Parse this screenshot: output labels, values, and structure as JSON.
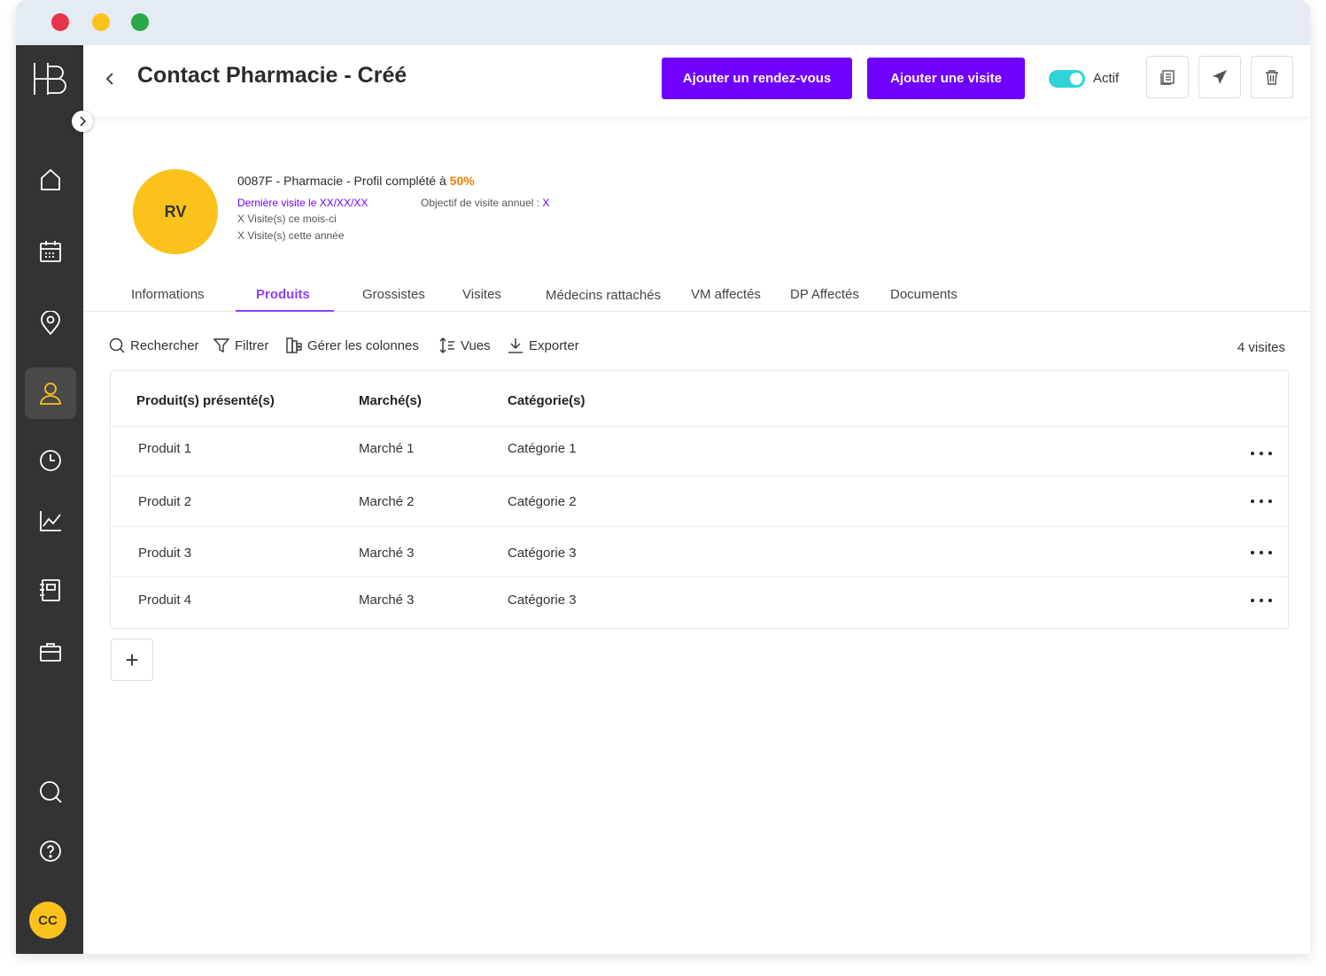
{
  "window": {
    "colors": {
      "close": "#e8334a",
      "minimize": "#fbc21b",
      "maximize": "#29a847"
    }
  },
  "sidebar": {
    "logo_text": "HB",
    "items": [
      {
        "name": "home-icon"
      },
      {
        "name": "calendar-icon"
      },
      {
        "name": "map-pin-icon"
      },
      {
        "name": "user-icon",
        "active": true
      },
      {
        "name": "clock-icon"
      },
      {
        "name": "chart-icon"
      },
      {
        "name": "notebook-icon"
      },
      {
        "name": "briefcase-icon"
      },
      {
        "name": "search-icon"
      },
      {
        "name": "help-icon"
      }
    ],
    "user_initials": "CC"
  },
  "header": {
    "title": "Contact Pharmacie - Créé",
    "add_appointment_label": "Ajouter un rendez-vous",
    "add_visit_label": "Ajouter une visite",
    "toggle_label": "Actif",
    "accent_color": "#7000ff"
  },
  "profile": {
    "initials": "RV",
    "name_prefix": "0087F - Pharmacie  - Profil complété à ",
    "completion": "50%",
    "last_visit": "Dernière visite le XX/XX/XX",
    "objective_label": "Objectif de visite annuel : ",
    "objective_value": "X",
    "visits_month": "X Visite(s) ce mois-ci",
    "visits_year": "X Visite(s) cette année"
  },
  "tabs": [
    {
      "label": "Informations"
    },
    {
      "label": "Produits",
      "active": true
    },
    {
      "label": "Grossistes"
    },
    {
      "label": "Visites"
    },
    {
      "label": "Médecins rattachés"
    },
    {
      "label": "VM affectés"
    },
    {
      "label": "DP Affectés"
    },
    {
      "label": "Documents"
    }
  ],
  "toolbar": {
    "search": "Rechercher",
    "filter": "Filtrer",
    "columns": "Gérer les colonnes",
    "views": "Vues",
    "export": "Exporter",
    "count": "4 visites"
  },
  "table": {
    "headers": [
      "Produit(s) présenté(s)",
      "Marché(s)",
      "Catégorie(s)"
    ],
    "rows": [
      [
        "Produit 1",
        "Marché 1",
        "Catégorie 1"
      ],
      [
        "Produit 2",
        "Marché 2",
        "Catégorie 2"
      ],
      [
        "Produit 3",
        "Marché 3",
        "Catégorie 3"
      ],
      [
        "Produit 4",
        "Marché 3",
        "Catégorie 3"
      ]
    ]
  },
  "add_button": "+"
}
